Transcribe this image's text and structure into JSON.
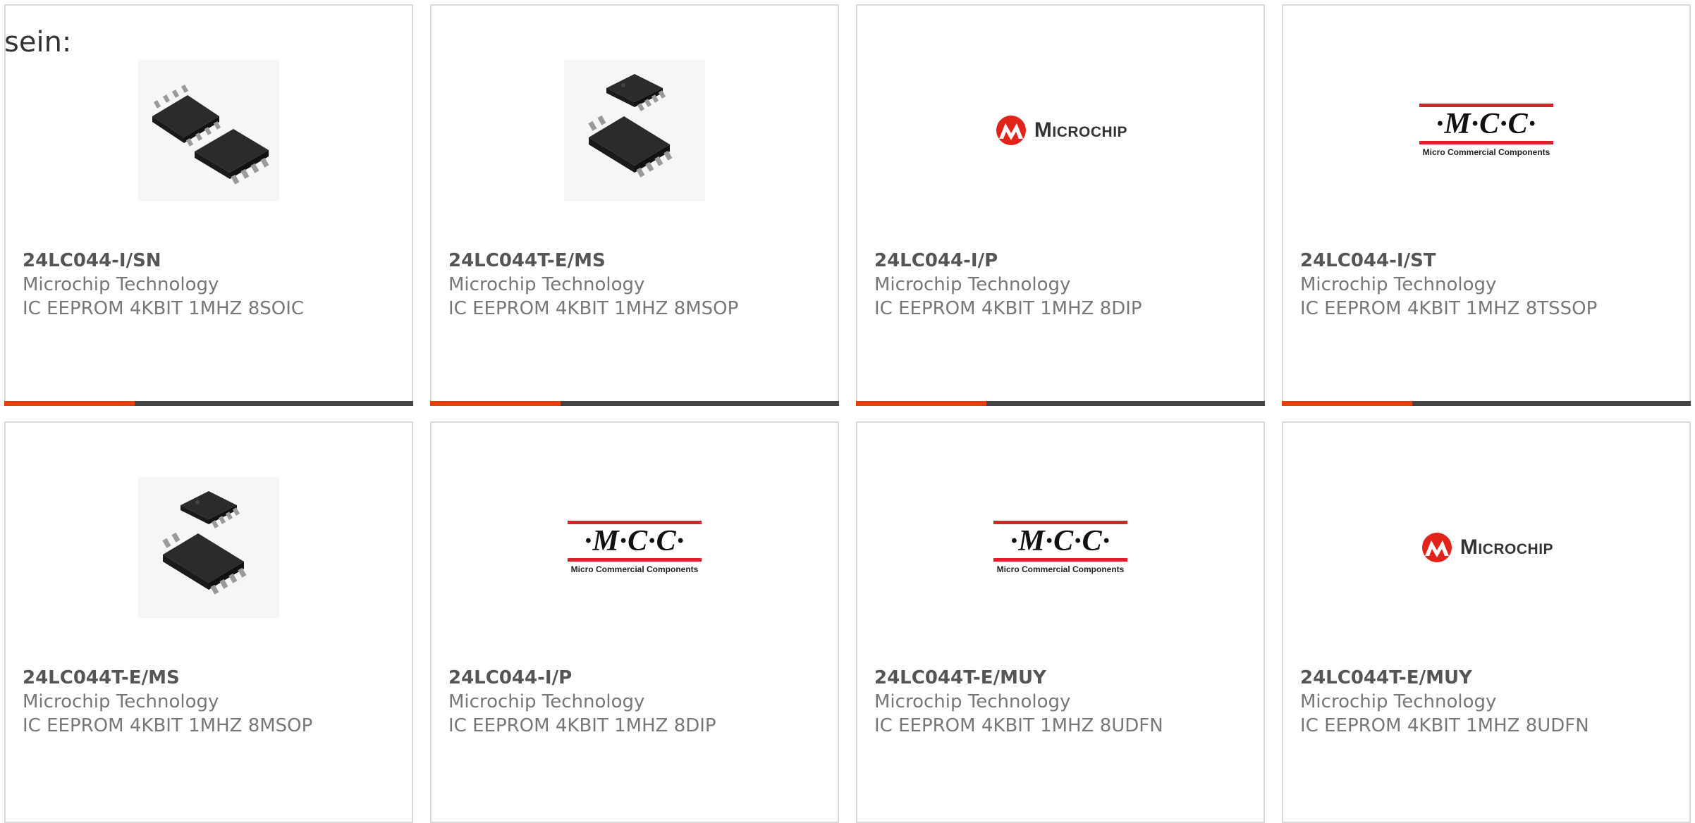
{
  "intro_text": "sein:",
  "colors": {
    "accent": "#e8400c",
    "bar_dark": "#444444",
    "mcc_red": "#d8232a",
    "microchip_red": "#e2231a"
  },
  "cards": [
    {
      "part_number": "24LC044-I/SN",
      "manufacturer": "Microchip Technology",
      "description": "IC EEPROM 4KBIT 1MHZ 8SOIC",
      "image": "soic-chip-icon"
    },
    {
      "part_number": "24LC044T-E/MS",
      "manufacturer": "Microchip Technology",
      "description": "IC EEPROM 4KBIT 1MHZ 8MSOP",
      "image": "msop-chip-icon"
    },
    {
      "part_number": "24LC044-I/P",
      "manufacturer": "Microchip Technology",
      "description": "IC EEPROM 4KBIT 1MHZ 8DIP",
      "image": "microchip-logo",
      "logo_text": "Microchip"
    },
    {
      "part_number": "24LC044-I/ST",
      "manufacturer": "Microchip Technology",
      "description": "IC EEPROM 4KBIT 1MHZ 8TSSOP",
      "image": "mcc-logo",
      "logo_text": "·M·C·C·",
      "logo_sub": "Micro Commercial Components"
    },
    {
      "part_number": "24LC044T-E/MS",
      "manufacturer": "Microchip Technology",
      "description": "IC EEPROM 4KBIT 1MHZ 8MSOP",
      "image": "msop-chip-icon"
    },
    {
      "part_number": "24LC044-I/P",
      "manufacturer": "Microchip Technology",
      "description": "IC EEPROM 4KBIT 1MHZ 8DIP",
      "image": "mcc-logo",
      "logo_text": "·M·C·C·",
      "logo_sub": "Micro Commercial Components"
    },
    {
      "part_number": "24LC044T-E/MUY",
      "manufacturer": "Microchip Technology",
      "description": "IC EEPROM 4KBIT 1MHZ 8UDFN",
      "image": "mcc-logo",
      "logo_text": "·M·C·C·",
      "logo_sub": "Micro Commercial Components"
    },
    {
      "part_number": "24LC044T-E/MUY",
      "manufacturer": "Microchip Technology",
      "description": "IC EEPROM 4KBIT 1MHZ 8UDFN",
      "image": "microchip-logo",
      "logo_text": "Microchip"
    }
  ]
}
